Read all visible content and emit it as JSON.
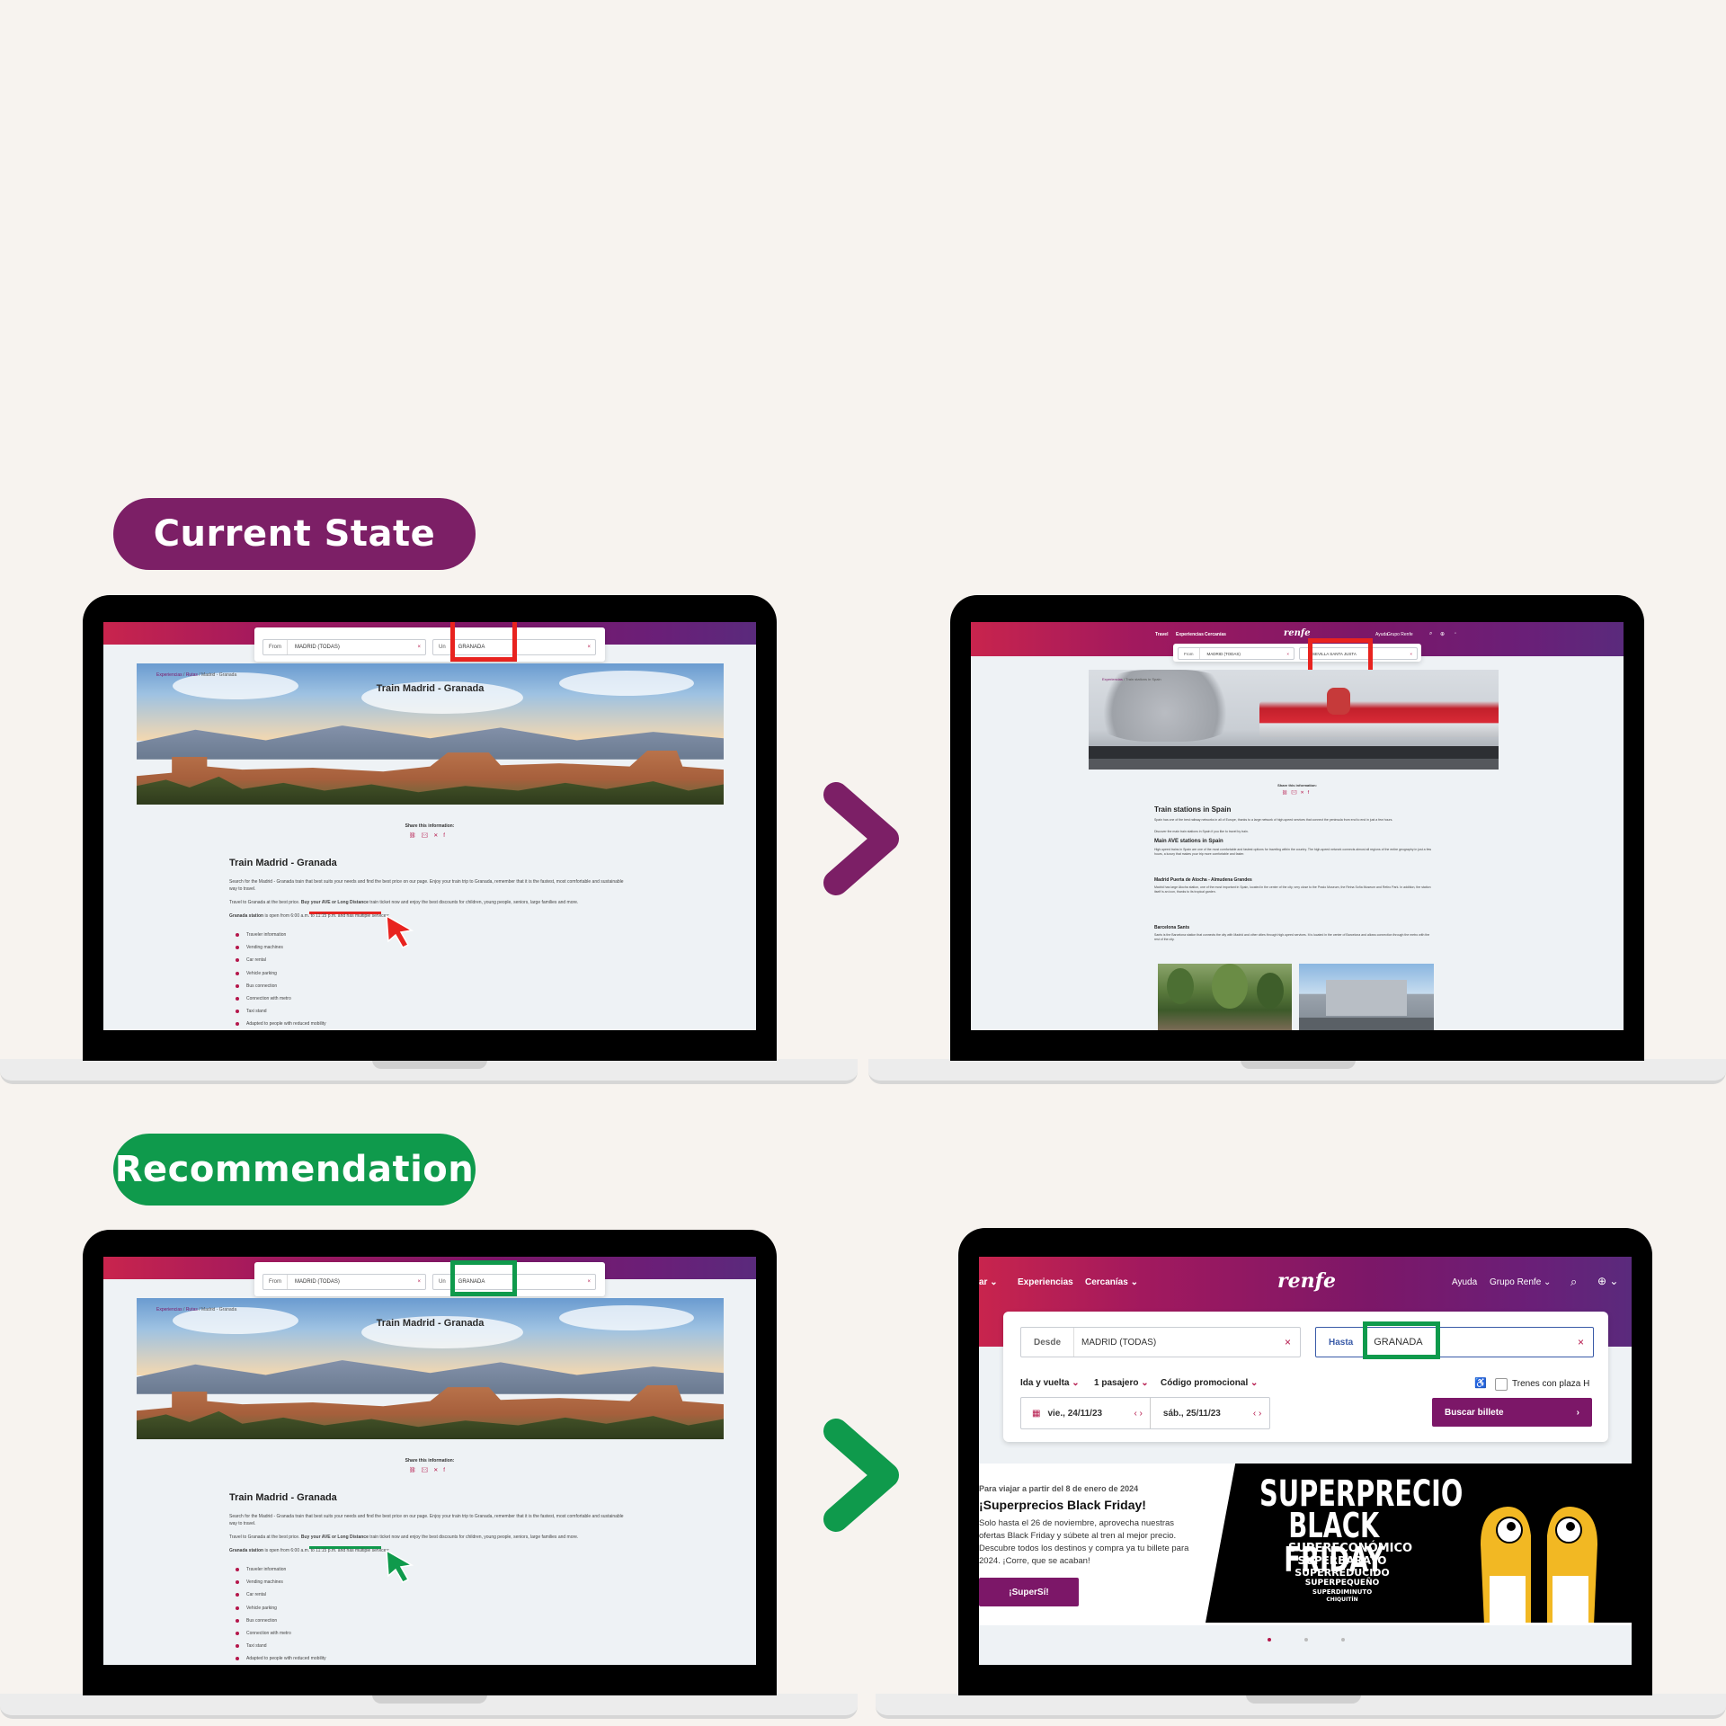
{
  "labels": {
    "current_state": "Current State",
    "recommendation": "Recommendation"
  },
  "colors": {
    "brand": "#7c1768",
    "current_pill": "#7c1f66",
    "recommendation_pill": "#0f9a4c",
    "highlight_bad": "#e8231f",
    "highlight_good": "#0f9a4c",
    "background": "#f7f3ef"
  },
  "route_page": {
    "search": {
      "from_label": "From",
      "from_value": "MADRID (TODAS)",
      "to_label": "Un",
      "to_value": "GRANADA"
    },
    "breadcrumb": [
      "Experiencias",
      "Rutas",
      "Madrid - Granada"
    ],
    "hero_title": "Train Madrid - Granada",
    "share_label": "Share this information:",
    "share_icons": [
      "link-icon",
      "mail-icon",
      "x-icon",
      "facebook-icon"
    ],
    "heading": "Train Madrid - Granada",
    "para1": "Search for the Madrid - Granada train that best suits your needs and find the best price on our page. Enjoy your train trip to Granada, remember that it is the fastest, most comfortable and sustainable way to travel.",
    "para2_prefix": "Travel to Granada at the best price.",
    "para2_link": "Buy your AVE or Long Distance",
    "para2_suffix": "train ticket now and enjoy the best discounts for children, young people, seniors, large families and more.",
    "para3_station": "Granada station",
    "para3_text": "is open from 6:00 a.m. to 11:15 p.m. and has multiple services:",
    "services": [
      "Traveler information",
      "Vending machines",
      "Car rental",
      "Vehicle parking",
      "Bus connection",
      "Connection with metro",
      "Taxi stand",
      "Adapted to people with reduced mobility"
    ]
  },
  "stations_page": {
    "nav": [
      "Travel",
      "Experiencias",
      "Cercanías"
    ],
    "logo": "renfe",
    "nav_right": [
      "Ayuda",
      "Grupo Renfe"
    ],
    "search": {
      "from_label": "From",
      "from_value": "MADRID (TODAS)",
      "to_value": "SEVILLA SANTA JUSTA"
    },
    "breadcrumb": [
      "Experiencias",
      "Train stations in Spain"
    ],
    "share_label": "Share this information:",
    "heading": "Train stations in Spain",
    "intro": "Spain has one of the best railway networks in all of Europe, thanks to a large network of high-speed services that connect the peninsula from end to end in just a few hours.",
    "intro2": "Discover the main train stations in Spain if you like to travel by train.",
    "sub1": "Main AVE stations in Spain",
    "sub1_text": "High-speed trains in Spain are one of the most comfortable and fastest options for traveling within the country. The high-speed network connects almost all regions of the entire geography in just a few hours, a luxury that makes your trip more comfortable and faster.",
    "sub2": "Madrid Puerta de Atocha - Almudena Grandes",
    "sub2_text": "Madrid has large Atocha station, one of the most important in Spain, located in the center of the city, very close to the Prado Museum, the Reina Sofía Museum and Retiro Park. In addition, the station itself is an icon, thanks to its tropical garden.",
    "sub3": "Barcelona Sants",
    "sub3_text": "Sants is the Barcelona station that connects the city with Madrid and other cities through high-speed services. It is located in the center of Barcelona and allows connection through the metro with the rest of the city."
  },
  "home_page": {
    "nav_left": [
      "ar",
      "Experiencias",
      "Cercanías"
    ],
    "logo": "renfe",
    "nav_right": [
      "Ayuda",
      "Grupo Renfe"
    ],
    "search": {
      "from_label": "Desde",
      "from_value": "MADRID (TODAS)",
      "to_label": "Hasta",
      "to_value": "GRANADA"
    },
    "options": [
      "Ida y vuelta",
      "1 pasajero",
      "Código promocional"
    ],
    "trenes_label": "Trenes con plaza H",
    "date_out": "vie., 24/11/23",
    "date_back": "sáb., 25/11/23",
    "buscar": "Buscar billete",
    "promo": {
      "pre": "Para viajar a partir del 8 de enero de 2024",
      "title": "¡Superprecios Black Friday!",
      "body": "Solo hasta el 26 de noviembre, aprovecha nuestras ofertas Black Friday y súbete al tren al mejor precio. Descubre todos los destinos y compra ya tu billete para 2024. ¡Corre, que se acaban!",
      "cta": "¡SuperSí!",
      "banner_line1": "SUPERPRECIO",
      "banner_line2": "BLACK FRIDAY",
      "banner_sub": [
        "SUPERECONÓMICO",
        "SUPERBARATO",
        "SUPERREDUCIDO",
        "SUPERPEQUEÑO",
        "SUPERDIMINUTO",
        "CHIQUITÍN"
      ]
    }
  }
}
